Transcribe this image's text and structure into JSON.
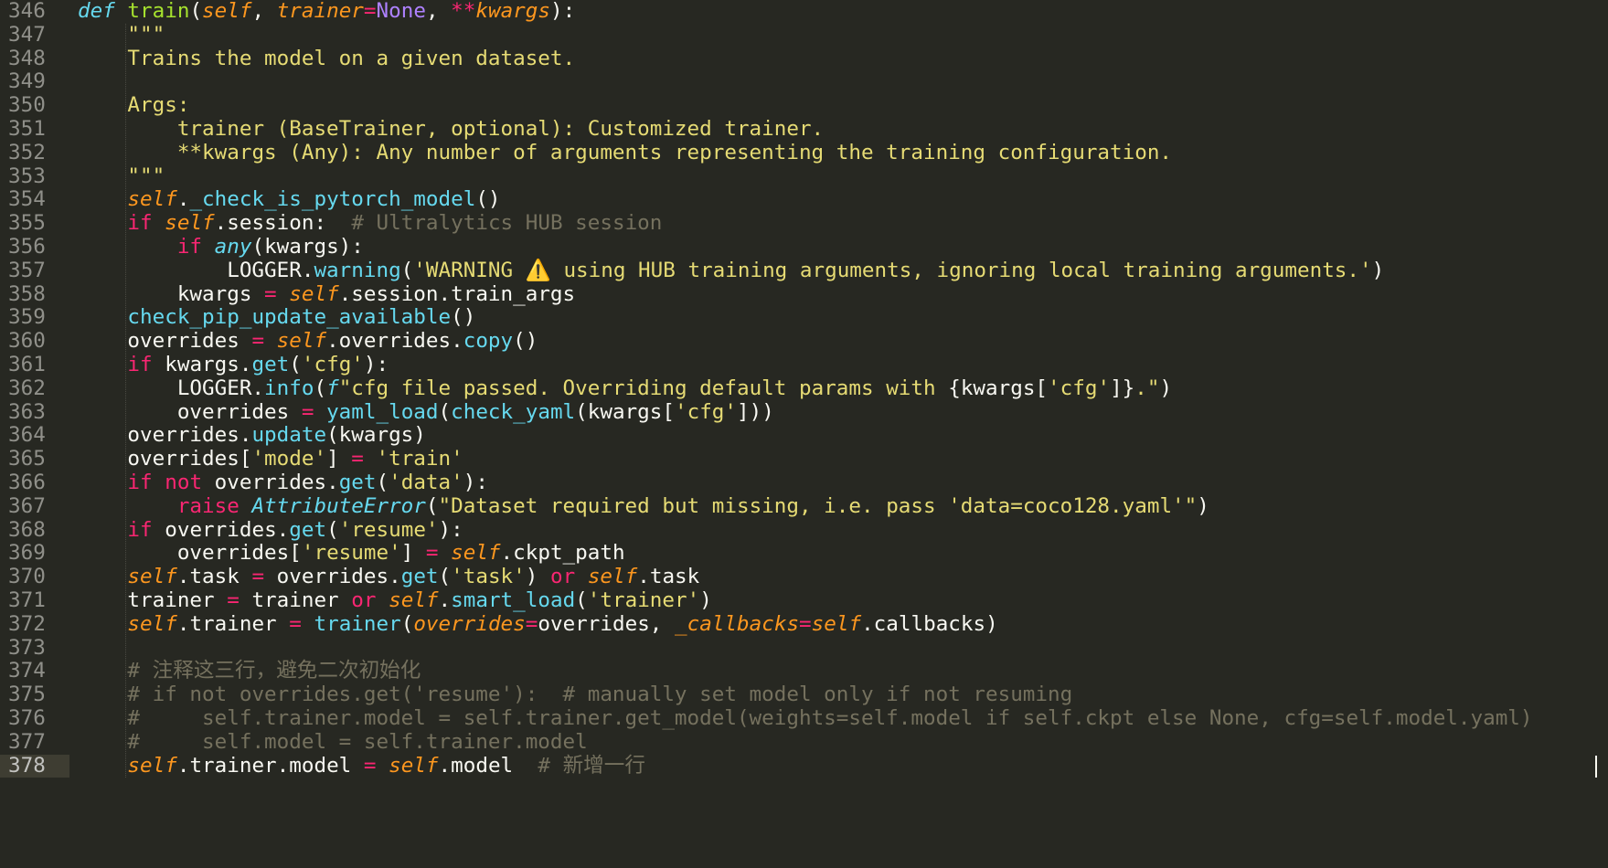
{
  "editor": {
    "theme": "monokai",
    "active_line": 378,
    "colors": {
      "background": "#272822",
      "gutter_text": "#90908A",
      "active_line_bg": "#3E3D32",
      "keyword": "#F92672",
      "function": "#A6E22E",
      "parameter": "#FD971F",
      "string": "#E6DB74",
      "comment": "#75715E",
      "call": "#66D9EF"
    }
  },
  "lines": [
    {
      "num": "346",
      "tokens": [
        [
          "kw-def",
          "def"
        ],
        [
          "plain",
          " "
        ],
        [
          "fn",
          "train"
        ],
        [
          "plain",
          "("
        ],
        [
          "param",
          "self"
        ],
        [
          "plain",
          ", "
        ],
        [
          "param",
          "trainer"
        ],
        [
          "op",
          "="
        ],
        [
          "const",
          "None"
        ],
        [
          "plain",
          ", "
        ],
        [
          "op",
          "**"
        ],
        [
          "param",
          "kwargs"
        ],
        [
          "plain",
          "):"
        ]
      ]
    },
    {
      "num": "347",
      "tokens": [
        [
          "plain",
          "    "
        ],
        [
          "doc",
          "\"\"\""
        ]
      ]
    },
    {
      "num": "348",
      "tokens": [
        [
          "plain",
          "    "
        ],
        [
          "doc",
          "Trains the model on a given dataset."
        ]
      ]
    },
    {
      "num": "349",
      "tokens": []
    },
    {
      "num": "350",
      "tokens": [
        [
          "plain",
          "    "
        ],
        [
          "doc",
          "Args:"
        ]
      ]
    },
    {
      "num": "351",
      "tokens": [
        [
          "plain",
          "        "
        ],
        [
          "doc",
          "trainer (BaseTrainer, optional): Customized trainer."
        ]
      ]
    },
    {
      "num": "352",
      "tokens": [
        [
          "plain",
          "        "
        ],
        [
          "doc",
          "**kwargs (Any): Any number of arguments representing the training configuration."
        ]
      ]
    },
    {
      "num": "353",
      "tokens": [
        [
          "plain",
          "    "
        ],
        [
          "doc",
          "\"\"\""
        ]
      ]
    },
    {
      "num": "354",
      "tokens": [
        [
          "plain",
          "    "
        ],
        [
          "selfv",
          "self"
        ],
        [
          "plain",
          "."
        ],
        [
          "call",
          "_check_is_pytorch_model"
        ],
        [
          "plain",
          "()"
        ]
      ]
    },
    {
      "num": "355",
      "tokens": [
        [
          "plain",
          "    "
        ],
        [
          "kw",
          "if"
        ],
        [
          "plain",
          " "
        ],
        [
          "selfv",
          "self"
        ],
        [
          "plain",
          ".session:  "
        ],
        [
          "cmt",
          "# Ultralytics HUB session"
        ]
      ]
    },
    {
      "num": "356",
      "tokens": [
        [
          "plain",
          "        "
        ],
        [
          "kw",
          "if"
        ],
        [
          "plain",
          " "
        ],
        [
          "builtin-i",
          "any"
        ],
        [
          "plain",
          "(kwargs):"
        ]
      ]
    },
    {
      "num": "357",
      "tokens": [
        [
          "plain",
          "            LOGGER."
        ],
        [
          "call",
          "warning"
        ],
        [
          "plain",
          "("
        ],
        [
          "str",
          "'WARNING ⚠️ using HUB training arguments, ignoring local training arguments.'"
        ],
        [
          "plain",
          ")"
        ]
      ]
    },
    {
      "num": "358",
      "tokens": [
        [
          "plain",
          "        kwargs "
        ],
        [
          "op",
          "="
        ],
        [
          "plain",
          " "
        ],
        [
          "selfv",
          "self"
        ],
        [
          "plain",
          ".session.train_args"
        ]
      ]
    },
    {
      "num": "359",
      "tokens": [
        [
          "plain",
          "    "
        ],
        [
          "call",
          "check_pip_update_available"
        ],
        [
          "plain",
          "()"
        ]
      ]
    },
    {
      "num": "360",
      "tokens": [
        [
          "plain",
          "    overrides "
        ],
        [
          "op",
          "="
        ],
        [
          "plain",
          " "
        ],
        [
          "selfv",
          "self"
        ],
        [
          "plain",
          ".overrides."
        ],
        [
          "call",
          "copy"
        ],
        [
          "plain",
          "()"
        ]
      ]
    },
    {
      "num": "361",
      "tokens": [
        [
          "plain",
          "    "
        ],
        [
          "kw",
          "if"
        ],
        [
          "plain",
          " kwargs."
        ],
        [
          "call",
          "get"
        ],
        [
          "plain",
          "("
        ],
        [
          "str",
          "'cfg'"
        ],
        [
          "plain",
          "):"
        ]
      ]
    },
    {
      "num": "362",
      "tokens": [
        [
          "plain",
          "        LOGGER."
        ],
        [
          "call",
          "info"
        ],
        [
          "plain",
          "("
        ],
        [
          "builtin-i",
          "f"
        ],
        [
          "str",
          "\"cfg file passed. Overriding default params with "
        ],
        [
          "plain",
          "{kwargs["
        ],
        [
          "str",
          "'cfg'"
        ],
        [
          "plain",
          "]}"
        ],
        [
          "str",
          ".\""
        ],
        [
          "plain",
          ")"
        ]
      ]
    },
    {
      "num": "363",
      "tokens": [
        [
          "plain",
          "        overrides "
        ],
        [
          "op",
          "="
        ],
        [
          "plain",
          " "
        ],
        [
          "call",
          "yaml_load"
        ],
        [
          "plain",
          "("
        ],
        [
          "call",
          "check_yaml"
        ],
        [
          "plain",
          "(kwargs["
        ],
        [
          "str",
          "'cfg'"
        ],
        [
          "plain",
          "]))"
        ]
      ]
    },
    {
      "num": "364",
      "tokens": [
        [
          "plain",
          "    overrides."
        ],
        [
          "call",
          "update"
        ],
        [
          "plain",
          "(kwargs)"
        ]
      ]
    },
    {
      "num": "365",
      "tokens": [
        [
          "plain",
          "    overrides["
        ],
        [
          "str",
          "'mode'"
        ],
        [
          "plain",
          "] "
        ],
        [
          "op",
          "="
        ],
        [
          "plain",
          " "
        ],
        [
          "str",
          "'train'"
        ]
      ]
    },
    {
      "num": "366",
      "tokens": [
        [
          "plain",
          "    "
        ],
        [
          "kw",
          "if"
        ],
        [
          "plain",
          " "
        ],
        [
          "kw",
          "not"
        ],
        [
          "plain",
          " overrides."
        ],
        [
          "call",
          "get"
        ],
        [
          "plain",
          "("
        ],
        [
          "str",
          "'data'"
        ],
        [
          "plain",
          "):"
        ]
      ]
    },
    {
      "num": "367",
      "tokens": [
        [
          "plain",
          "        "
        ],
        [
          "kw",
          "raise"
        ],
        [
          "plain",
          " "
        ],
        [
          "builtin-i",
          "AttributeError"
        ],
        [
          "plain",
          "("
        ],
        [
          "str",
          "\"Dataset required but missing, i.e. pass 'data=coco128.yaml'\""
        ],
        [
          "plain",
          ")"
        ]
      ]
    },
    {
      "num": "368",
      "tokens": [
        [
          "plain",
          "    "
        ],
        [
          "kw",
          "if"
        ],
        [
          "plain",
          " overrides."
        ],
        [
          "call",
          "get"
        ],
        [
          "plain",
          "("
        ],
        [
          "str",
          "'resume'"
        ],
        [
          "plain",
          "):"
        ]
      ]
    },
    {
      "num": "369",
      "tokens": [
        [
          "plain",
          "        overrides["
        ],
        [
          "str",
          "'resume'"
        ],
        [
          "plain",
          "] "
        ],
        [
          "op",
          "="
        ],
        [
          "plain",
          " "
        ],
        [
          "selfv",
          "self"
        ],
        [
          "plain",
          ".ckpt_path"
        ]
      ]
    },
    {
      "num": "370",
      "tokens": [
        [
          "plain",
          "    "
        ],
        [
          "selfv",
          "self"
        ],
        [
          "plain",
          ".task "
        ],
        [
          "op",
          "="
        ],
        [
          "plain",
          " overrides."
        ],
        [
          "call",
          "get"
        ],
        [
          "plain",
          "("
        ],
        [
          "str",
          "'task'"
        ],
        [
          "plain",
          ") "
        ],
        [
          "kw",
          "or"
        ],
        [
          "plain",
          " "
        ],
        [
          "selfv",
          "self"
        ],
        [
          "plain",
          ".task"
        ]
      ]
    },
    {
      "num": "371",
      "tokens": [
        [
          "plain",
          "    trainer "
        ],
        [
          "op",
          "="
        ],
        [
          "plain",
          " trainer "
        ],
        [
          "kw",
          "or"
        ],
        [
          "plain",
          " "
        ],
        [
          "selfv",
          "self"
        ],
        [
          "plain",
          "."
        ],
        [
          "call",
          "smart_load"
        ],
        [
          "plain",
          "("
        ],
        [
          "str",
          "'trainer'"
        ],
        [
          "plain",
          ")"
        ]
      ]
    },
    {
      "num": "372",
      "tokens": [
        [
          "plain",
          "    "
        ],
        [
          "selfv",
          "self"
        ],
        [
          "plain",
          ".trainer "
        ],
        [
          "op",
          "="
        ],
        [
          "plain",
          " "
        ],
        [
          "call",
          "trainer"
        ],
        [
          "plain",
          "("
        ],
        [
          "param",
          "overrides"
        ],
        [
          "op",
          "="
        ],
        [
          "plain",
          "overrides, "
        ],
        [
          "param",
          "_callbacks"
        ],
        [
          "op",
          "="
        ],
        [
          "selfv",
          "self"
        ],
        [
          "plain",
          ".callbacks)"
        ]
      ]
    },
    {
      "num": "373",
      "tokens": []
    },
    {
      "num": "374",
      "tokens": [
        [
          "plain",
          "    "
        ],
        [
          "cmt",
          "# 注释这三行，避免二次初始化"
        ]
      ]
    },
    {
      "num": "375",
      "tokens": [
        [
          "plain",
          "    "
        ],
        [
          "cmt",
          "# if not overrides.get('resume'):  # manually set model only if not resuming"
        ]
      ]
    },
    {
      "num": "376",
      "tokens": [
        [
          "plain",
          "    "
        ],
        [
          "cmt",
          "#     self.trainer.model = self.trainer.get_model(weights=self.model if self.ckpt else None, cfg=self.model.yaml)"
        ]
      ]
    },
    {
      "num": "377",
      "tokens": [
        [
          "plain",
          "    "
        ],
        [
          "cmt",
          "#     self.model = self.trainer.model"
        ]
      ]
    },
    {
      "num": "378",
      "tokens": [
        [
          "plain",
          "    "
        ],
        [
          "selfv",
          "self"
        ],
        [
          "plain",
          ".trainer.model "
        ],
        [
          "op",
          "="
        ],
        [
          "plain",
          " "
        ],
        [
          "selfv",
          "self"
        ],
        [
          "plain",
          ".model  "
        ],
        [
          "cmt",
          "# 新增一行"
        ]
      ]
    }
  ]
}
